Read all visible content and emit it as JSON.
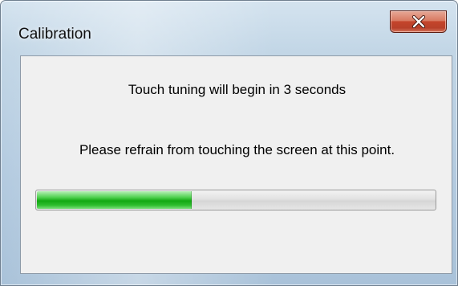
{
  "window": {
    "title": "Calibration",
    "close_icon": "close-icon"
  },
  "dialog": {
    "countdown_text": "Touch tuning will begin in 3 seconds",
    "instruction_text": "Please refrain from touching the screen at this point."
  },
  "progress": {
    "percent": 39,
    "fill_color": "#1bb01b"
  }
}
